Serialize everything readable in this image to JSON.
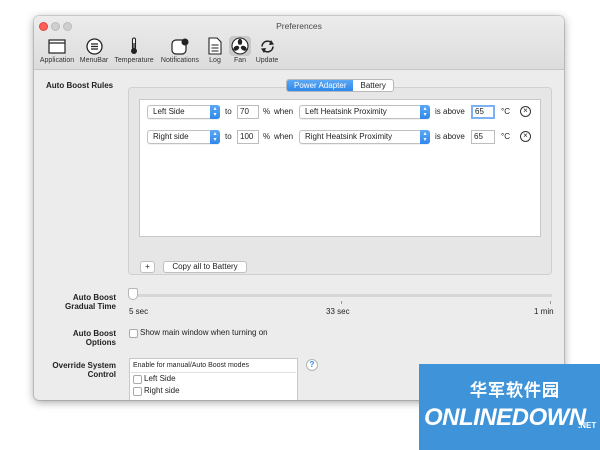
{
  "window": {
    "title": "Preferences"
  },
  "toolbar": {
    "items": [
      {
        "label": "Application",
        "icon": "application-window-icon"
      },
      {
        "label": "MenuBar",
        "icon": "menu-lines-icon"
      },
      {
        "label": "Temperature",
        "icon": "thermometer-icon"
      },
      {
        "label": "Notifications",
        "icon": "notification-badge-icon"
      },
      {
        "label": "Log",
        "icon": "document-log-icon"
      },
      {
        "label": "Fan",
        "icon": "fan-icon",
        "selected": true
      },
      {
        "label": "Update",
        "icon": "refresh-arrows-icon"
      }
    ]
  },
  "auto_boost_rules": {
    "label": "Auto Boost  Rules",
    "tabs": [
      {
        "label": "Power Adapter",
        "active": true
      },
      {
        "label": "Battery",
        "active": false
      }
    ],
    "rules": [
      {
        "side": "Left Side",
        "to_label": "to",
        "percent": "70",
        "percent_unit": "%",
        "when_label": "when",
        "sensor": "Left Heatsink Proximity",
        "condition": "is above",
        "threshold": "65",
        "unit": "°C"
      },
      {
        "side": "Right side",
        "to_label": "to",
        "percent": "100",
        "percent_unit": "%",
        "when_label": "when",
        "sensor": "Right Heatsink Proximity",
        "condition": "is above",
        "threshold": "65",
        "unit": "°C"
      }
    ],
    "add_button": "+",
    "copy_button": "Copy all to Battery"
  },
  "gradual_time": {
    "label_line1": "Auto Boost",
    "label_line2": "Gradual Time",
    "tick_labels": [
      "5 sec",
      "33 sec",
      "1 min"
    ],
    "value": "5 sec"
  },
  "options": {
    "label_line1": "Auto Boost",
    "label_line2": "Options",
    "checkbox_label": "Show main window when turning on",
    "checked": false
  },
  "override": {
    "label_line1": "Override System",
    "label_line2": "Control",
    "list_header": "Enable for manual/Auto Boost modes",
    "items": [
      {
        "label": "Left Side",
        "checked": false
      },
      {
        "label": "Right side",
        "checked": false
      }
    ],
    "help_symbol": "?"
  },
  "watermark": {
    "cn_text": "华军软件园",
    "en_text": "ONLINEDOWN",
    "suffix": ".NET"
  },
  "colors": {
    "accent": "#2e88ec",
    "close_button": "#ff5f57",
    "watermark_bg": "#3f93d9"
  }
}
